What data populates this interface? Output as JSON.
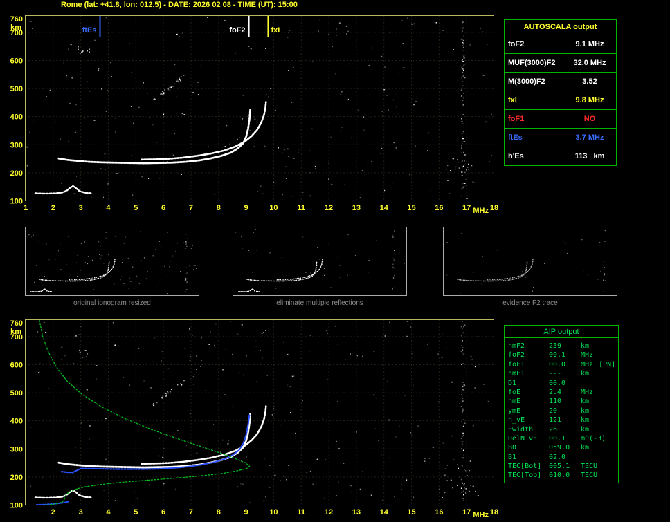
{
  "title": "Rome (lat: +41.8, lon: 012.5) - DATE: 2026 02 08 - TIME (UT): 15:00",
  "colors": {
    "white": "#ffffff",
    "yellow": "#ffff2e",
    "red": "#ff2a2a",
    "blue": "#3a6cff",
    "green_border": "#00b400",
    "green_text": "#00e555",
    "plot_border": "#b9b95e",
    "axis_text": "#ffff2e",
    "trace_white": "#ffffff",
    "trace_blue": "#2b50ff",
    "profile_green": "#00c020",
    "caption_gray": "#8f8f8f"
  },
  "autoscala_table": {
    "title": "AUTOSCALA output",
    "rows": [
      {
        "param": "foF2",
        "value": "9.1 MHz",
        "color": "white"
      },
      {
        "param": "MUF(3000)F2",
        "value": "32.0 MHz",
        "color": "white"
      },
      {
        "param": "M(3000)F2",
        "value": "3.52",
        "color": "white"
      },
      {
        "param": "fxI",
        "value": "9.8 MHz",
        "color": "yellow"
      },
      {
        "param": "foF1",
        "value": "NO",
        "color": "red"
      },
      {
        "param": "ftEs",
        "value": "3.7 MHz",
        "color": "blue"
      },
      {
        "param": "h'Es",
        "value": "113   km",
        "color": "white"
      }
    ]
  },
  "aip_table": {
    "title": "AIP output",
    "rows": [
      {
        "param": "hmF2",
        "value": "239",
        "unit": "km"
      },
      {
        "param": "foF2",
        "value": "09.1",
        "unit": "MHz"
      },
      {
        "param": "foF1",
        "value": "00.0",
        "unit": "MHz",
        "note": "[PN]"
      },
      {
        "param": "hmF1",
        "value": "---",
        "unit": "km"
      },
      {
        "param": "D1",
        "value": "00.0",
        "unit": ""
      },
      {
        "param": "foE",
        "value": "2.4",
        "unit": "MHz"
      },
      {
        "param": "hmE",
        "value": "110",
        "unit": "km"
      },
      {
        "param": "ymE",
        "value": "20",
        "unit": "km"
      },
      {
        "param": "h_vE",
        "value": "121",
        "unit": "km"
      },
      {
        "param": "Ewidth",
        "value": "26",
        "unit": "km"
      },
      {
        "param": "DelN_vE",
        "value": "00.1",
        "unit": "m^(-3)"
      },
      {
        "param": "B0",
        "value": "059.0",
        "unit": "km"
      },
      {
        "param": "B1",
        "value": "02.0",
        "unit": ""
      },
      {
        "param": "TEC[Bot]",
        "value": "005.1",
        "unit": "TECU"
      },
      {
        "param": "TEC[Top]",
        "value": "010.0",
        "unit": "TECU"
      }
    ]
  },
  "thumbnails": [
    {
      "caption": "original ionogram resized"
    },
    {
      "caption": "eliminate multiple reflections"
    },
    {
      "caption": "evidence F2 trace"
    }
  ],
  "chart_data": [
    {
      "type": "scatter",
      "name": "main ionogram with autoscaled characteristics",
      "xlabel": "MHz",
      "ylabel": "km",
      "xlim": [
        1,
        18
      ],
      "ylim": [
        100,
        760
      ],
      "grid": true,
      "x_ticks": [
        1,
        2,
        3,
        4,
        5,
        6,
        7,
        8,
        9,
        10,
        11,
        12,
        13,
        14,
        15,
        16,
        17,
        18
      ],
      "y_ticks": [
        760,
        700,
        600,
        500,
        400,
        300,
        200,
        100
      ],
      "markers": [
        {
          "label": "ftEs",
          "freq": 3.7,
          "color": "#3a6cff",
          "label_side": "left"
        },
        {
          "label": "foF2",
          "freq": 9.1,
          "color": "#ffffff",
          "label_side": "left"
        },
        {
          "label": "fxI",
          "freq": 9.8,
          "color": "#ffff2e",
          "label_side": "right"
        }
      ],
      "series": [
        {
          "id": "f2-ordinary-trace",
          "color": "#ffffff",
          "width": 2.8,
          "dash": "2.5,1.8",
          "points": [
            [
              2.2,
              251
            ],
            [
              2.5,
              246
            ],
            [
              2.9,
              242
            ],
            [
              3.3,
              239
            ],
            [
              3.8,
              237
            ],
            [
              4.3,
              236
            ],
            [
              4.8,
              235
            ],
            [
              5.3,
              234
            ],
            [
              5.8,
              235
            ],
            [
              6.3,
              236
            ],
            [
              6.8,
              239
            ],
            [
              7.3,
              244
            ],
            [
              7.7,
              251
            ],
            [
              8.1,
              260
            ],
            [
              8.45,
              272
            ],
            [
              8.7,
              287
            ],
            [
              8.9,
              306
            ],
            [
              9.0,
              328
            ],
            [
              9.07,
              356
            ],
            [
              9.12,
              390
            ],
            [
              9.15,
              425
            ]
          ]
        },
        {
          "id": "f2-extraordinary-trace",
          "color": "#ffffff",
          "width": 2.6,
          "dash": "2.5,1.8",
          "points": [
            [
              5.2,
              247
            ],
            [
              5.7,
              248
            ],
            [
              6.2,
              250
            ],
            [
              6.7,
              254
            ],
            [
              7.2,
              260
            ],
            [
              7.7,
              268
            ],
            [
              8.2,
              279
            ],
            [
              8.6,
              293
            ],
            [
              8.95,
              311
            ],
            [
              9.2,
              331
            ],
            [
              9.4,
              353
            ],
            [
              9.55,
              379
            ],
            [
              9.65,
              406
            ],
            [
              9.7,
              433
            ],
            [
              9.72,
              452
            ]
          ]
        },
        {
          "id": "sporadic-e-trace",
          "color": "#ffffff",
          "width": 2.4,
          "dash": "3,2.2",
          "points": [
            [
              1.35,
              127
            ],
            [
              1.6,
              126
            ],
            [
              1.85,
              126
            ],
            [
              2.1,
              127
            ],
            [
              2.35,
              130
            ],
            [
              2.5,
              137
            ],
            [
              2.62,
              147
            ],
            [
              2.72,
              153
            ],
            [
              2.82,
              146
            ],
            [
              2.95,
              135
            ],
            [
              3.15,
              129
            ],
            [
              3.4,
              127
            ]
          ]
        }
      ]
    },
    {
      "type": "scatter",
      "name": "ionogram with restored trace and electron density profile",
      "xlabel": "MHz",
      "ylabel": "km",
      "xlim": [
        1,
        18
      ],
      "ylim": [
        100,
        760
      ],
      "grid": true,
      "x_ticks": [
        2,
        3,
        4,
        5,
        6,
        7,
        8,
        9,
        10,
        11,
        12,
        13,
        14,
        15,
        16,
        17,
        18
      ],
      "y_ticks": [
        760,
        700,
        600,
        500,
        400,
        300,
        200,
        100
      ],
      "markers": [],
      "series": [
        {
          "id": "f2-ordinary-trace",
          "color": "#ffffff",
          "width": 2.8,
          "dash": "2.5,1.8",
          "points": [
            [
              2.2,
              251
            ],
            [
              2.5,
              246
            ],
            [
              2.9,
              242
            ],
            [
              3.3,
              239
            ],
            [
              3.8,
              237
            ],
            [
              4.3,
              236
            ],
            [
              4.8,
              235
            ],
            [
              5.3,
              234
            ],
            [
              5.8,
              235
            ],
            [
              6.3,
              236
            ],
            [
              6.8,
              239
            ],
            [
              7.3,
              244
            ],
            [
              7.7,
              251
            ],
            [
              8.1,
              260
            ],
            [
              8.45,
              272
            ],
            [
              8.7,
              287
            ],
            [
              8.9,
              306
            ],
            [
              9.0,
              328
            ],
            [
              9.07,
              356
            ],
            [
              9.12,
              390
            ],
            [
              9.15,
              425
            ]
          ]
        },
        {
          "id": "f2-extraordinary-trace",
          "color": "#ffffff",
          "width": 2.6,
          "dash": "2.5,1.8",
          "points": [
            [
              5.2,
              247
            ],
            [
              5.7,
              248
            ],
            [
              6.2,
              250
            ],
            [
              6.7,
              254
            ],
            [
              7.2,
              260
            ],
            [
              7.7,
              268
            ],
            [
              8.2,
              279
            ],
            [
              8.6,
              293
            ],
            [
              8.95,
              311
            ],
            [
              9.2,
              331
            ],
            [
              9.4,
              353
            ],
            [
              9.55,
              379
            ],
            [
              9.65,
              406
            ],
            [
              9.7,
              433
            ],
            [
              9.72,
              452
            ]
          ]
        },
        {
          "id": "sporadic-e-trace",
          "color": "#ffffff",
          "width": 2.4,
          "dash": "3,2.2",
          "points": [
            [
              1.35,
              127
            ],
            [
              1.6,
              126
            ],
            [
              1.85,
              126
            ],
            [
              2.1,
              127
            ],
            [
              2.35,
              130
            ],
            [
              2.5,
              137
            ],
            [
              2.62,
              147
            ],
            [
              2.72,
              153
            ],
            [
              2.82,
              146
            ],
            [
              2.95,
              135
            ],
            [
              3.15,
              129
            ],
            [
              3.4,
              127
            ]
          ]
        },
        {
          "id": "restored-trace",
          "color": "#2b50ff",
          "width": 2.2,
          "dash": "2,2",
          "points": [
            [
              2.3,
              219
            ],
            [
              2.5,
              217
            ],
            [
              2.7,
              216
            ],
            [
              3.0,
              230
            ],
            [
              3.4,
              230
            ],
            [
              3.8,
              229
            ],
            [
              4.2,
              228
            ],
            [
              4.6,
              228
            ],
            [
              5.0,
              228
            ],
            [
              5.4,
              228
            ],
            [
              5.8,
              229
            ],
            [
              6.2,
              231
            ],
            [
              6.6,
              234
            ],
            [
              7.0,
              238
            ],
            [
              7.4,
              244
            ],
            [
              7.8,
              252
            ],
            [
              8.2,
              263
            ],
            [
              8.5,
              277
            ],
            [
              8.75,
              296
            ],
            [
              8.9,
              320
            ],
            [
              9.0,
              350
            ],
            [
              9.07,
              385
            ],
            [
              9.12,
              420
            ]
          ]
        },
        {
          "id": "restored-es-trace",
          "color": "#2b50ff",
          "width": 2.0,
          "dash": "2,2",
          "points": [
            [
              1.4,
              101
            ],
            [
              1.7,
              102
            ],
            [
              2.0,
              104
            ],
            [
              2.3,
              107
            ],
            [
              2.55,
              112
            ]
          ]
        },
        {
          "id": "electron-density-profile",
          "color": "#00c020",
          "width": 1.3,
          "dash": "2,2.6",
          "points": [
            [
              1.5,
              758
            ],
            [
              1.62,
              700
            ],
            [
              1.82,
              646
            ],
            [
              2.1,
              594
            ],
            [
              2.5,
              542
            ],
            [
              3.05,
              494
            ],
            [
              3.75,
              450
            ],
            [
              4.6,
              408
            ],
            [
              5.6,
              368
            ],
            [
              6.7,
              330
            ],
            [
              7.75,
              296
            ],
            [
              8.55,
              268
            ],
            [
              8.98,
              250
            ],
            [
              9.12,
              239
            ],
            [
              9.03,
              231
            ],
            [
              8.68,
              222
            ],
            [
              8.1,
              212
            ],
            [
              7.25,
              203
            ],
            [
              6.3,
              195
            ],
            [
              5.35,
              188
            ],
            [
              4.45,
              181
            ],
            [
              3.7,
              173
            ],
            [
              3.15,
              165
            ],
            [
              2.8,
              156
            ],
            [
              2.58,
              147
            ],
            [
              2.47,
              137
            ],
            [
              2.42,
              127
            ],
            [
              2.4,
              118
            ],
            [
              2.33,
              111
            ],
            [
              2.12,
              105
            ],
            [
              1.85,
              101
            ],
            [
              1.6,
              99
            ]
          ]
        }
      ]
    }
  ]
}
